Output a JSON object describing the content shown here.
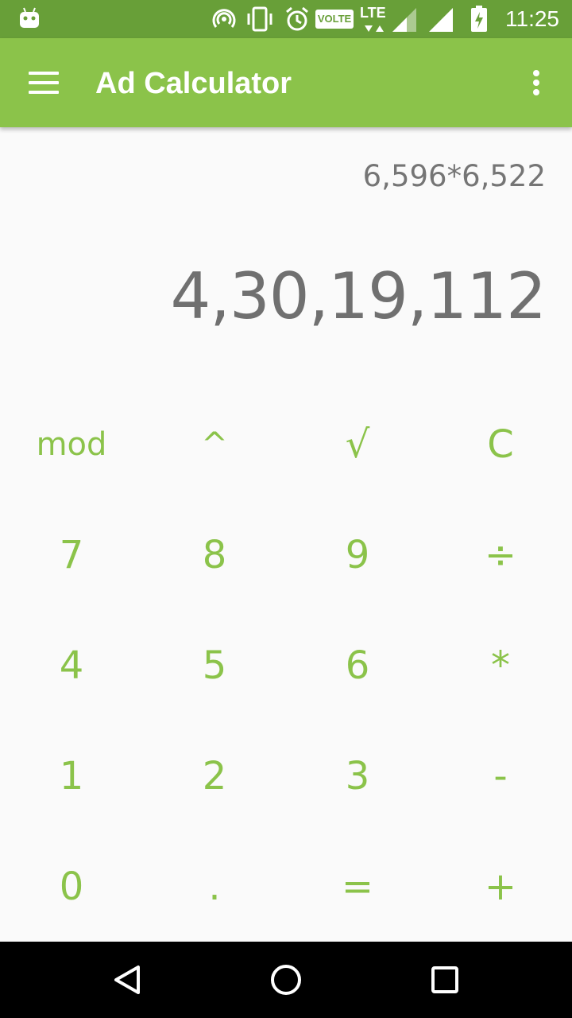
{
  "status_bar": {
    "time": "11:25",
    "network_badge": "VOLTE",
    "network_type": "LTE",
    "icons": [
      "android-icon",
      "hotspot-icon",
      "vibrate-icon",
      "alarm-icon",
      "volte-icon",
      "lte-icon",
      "signal-icon",
      "signal-icon",
      "battery-charging-icon"
    ]
  },
  "app_bar": {
    "title": "Ad Calculator",
    "menu_icon": "hamburger-menu-icon",
    "overflow_icon": "more-vert-icon"
  },
  "display": {
    "expression": "6,596*6,522",
    "result": "4,30,19,112"
  },
  "keypad": {
    "rows": [
      [
        "mod",
        "^",
        "√",
        "C"
      ],
      [
        "7",
        "8",
        "9",
        "÷"
      ],
      [
        "4",
        "5",
        "6",
        "*"
      ],
      [
        "1",
        "2",
        "3",
        "-"
      ],
      [
        "0",
        ".",
        "=",
        "+"
      ]
    ]
  },
  "nav_bar": {
    "icons": [
      "back-icon",
      "home-icon",
      "recents-icon"
    ]
  },
  "colors": {
    "status_bar": "#689f38",
    "app_bar": "#8bc34a",
    "accent": "#8bc34a",
    "background": "#fafafa",
    "text": "#757575"
  }
}
